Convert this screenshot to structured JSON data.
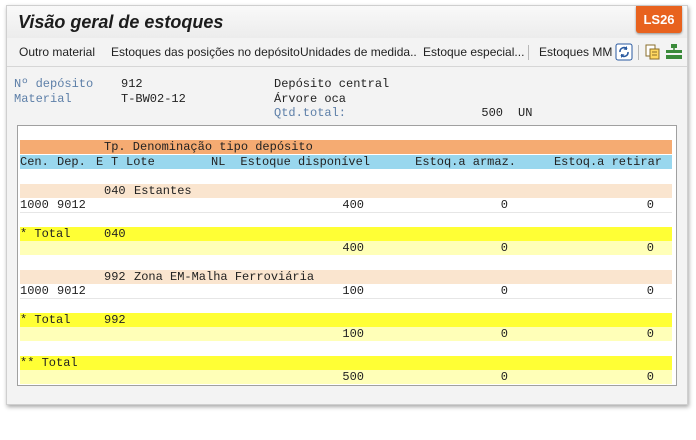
{
  "window": {
    "title": "Visão geral de estoques",
    "tcode": "LS26"
  },
  "toolbar": {
    "outro_material": "Outro material",
    "estoques_posicoes": "Estoques das posições no depósito",
    "unidades_medida": "Unidades de medida..",
    "estoque_especial": "Estoque especial...",
    "estoques_mm": "Estoques MM",
    "icons": [
      "refresh-icon",
      "copy-icon",
      "hierarchy-icon"
    ]
  },
  "header": {
    "deposito_label": "Nº depósito",
    "deposito_value": "912",
    "deposito_desc": "Depósito central",
    "material_label": "Material",
    "material_value": "T-BW02-12",
    "material_desc": "Árvore oca",
    "qtd_label": "Qtd.total:",
    "qtd_value": "500",
    "qtd_unit": "UN"
  },
  "grid": {
    "header1": {
      "tp_denom": "Tp. Denominação tipo depósito"
    },
    "header2": {
      "cen": "Cen.",
      "dep": "Dep.",
      "e": "E",
      "t": "T",
      "lote": "Lote",
      "nl": "NL",
      "estoque_disp": "Estoque disponível",
      "armaz": "Estoq.a armaz.",
      "retirar": "Estoq.a retirar"
    },
    "group1": {
      "type_code": "040",
      "type_desc": "Estantes",
      "row": {
        "cen": "1000",
        "dep": "9012",
        "disp": "400",
        "armaz": "0",
        "retirar": "0"
      },
      "total_label": "* Total",
      "total_code": "040",
      "total": {
        "disp": "400",
        "armaz": "0",
        "retirar": "0"
      }
    },
    "group2": {
      "type_code": "992",
      "type_desc": "Zona EM-Malha Ferroviária",
      "row": {
        "cen": "1000",
        "dep": "9012",
        "disp": "100",
        "armaz": "0",
        "retirar": "0"
      },
      "total_label": "* Total",
      "total_code": "992",
      "total": {
        "disp": "100",
        "armaz": "0",
        "retirar": "0"
      }
    },
    "grand_total": {
      "label": "** Total",
      "disp": "500",
      "armaz": "0",
      "retirar": "0"
    }
  },
  "colors": {
    "header_orange": "#f5ab72",
    "header_blue": "#99d7ee",
    "group_beige": "#fae5cf",
    "total_yellow": "#ffff35",
    "total_light_yellow": "#ffffb8",
    "tcode_badge": "#e8621e"
  }
}
